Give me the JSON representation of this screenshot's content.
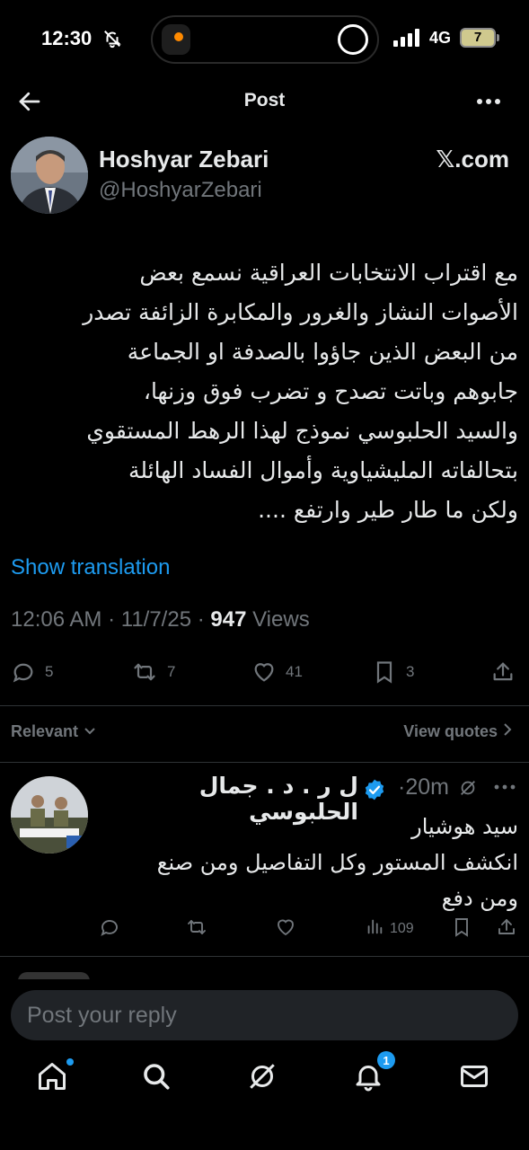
{
  "status_bar": {
    "time": "12:30",
    "network": "4G",
    "battery": "7"
  },
  "header": {
    "title": "Post"
  },
  "post": {
    "author_name": "Hoshyar Zebari",
    "author_handle": "@HoshyarZebari",
    "source": "𝕏.com",
    "text_lines": [
      "مع اقتراب الانتخابات العراقية نسمع بعض",
      "الأصوات النشاز والغرور والمكابرة الزائفة تصدر",
      "من البعض الذين جاؤوا بالصدفة او الجماعة",
      "جابوهم وباتت تصدح و تضرب فوق وزنها،",
      "والسيد الحلبوسي نموذج لهذا الرهط المستقوي",
      "بتحالفاته المليشياوية وأموال الفساد الهائلة",
      "ولكن ما طار طير وارتفع ...."
    ],
    "show_translation": "Show translation",
    "time": "12:06 AM",
    "date": "11/7/25",
    "views_count": "947",
    "views_label": "Views",
    "replies": "5",
    "reposts": "7",
    "likes": "41",
    "bookmarks": "3"
  },
  "sort": {
    "relevant": "Relevant",
    "view_quotes": "View quotes"
  },
  "reply": {
    "name": "ل ر . د . جمال الحلبوسي",
    "time": "·20m",
    "text_lines": [
      "سيد هوشيار",
      "انكشف المستور وكل التفاصيل ومن صنع",
      "ومن دفع"
    ],
    "views": "109"
  },
  "composer": {
    "placeholder": "Post your reply"
  },
  "tabs": {
    "notifications_badge": "1"
  },
  "colors": {
    "accent": "#1d9bf0",
    "muted": "#71767b",
    "text": "#e7e9ea",
    "background": "#000000"
  }
}
